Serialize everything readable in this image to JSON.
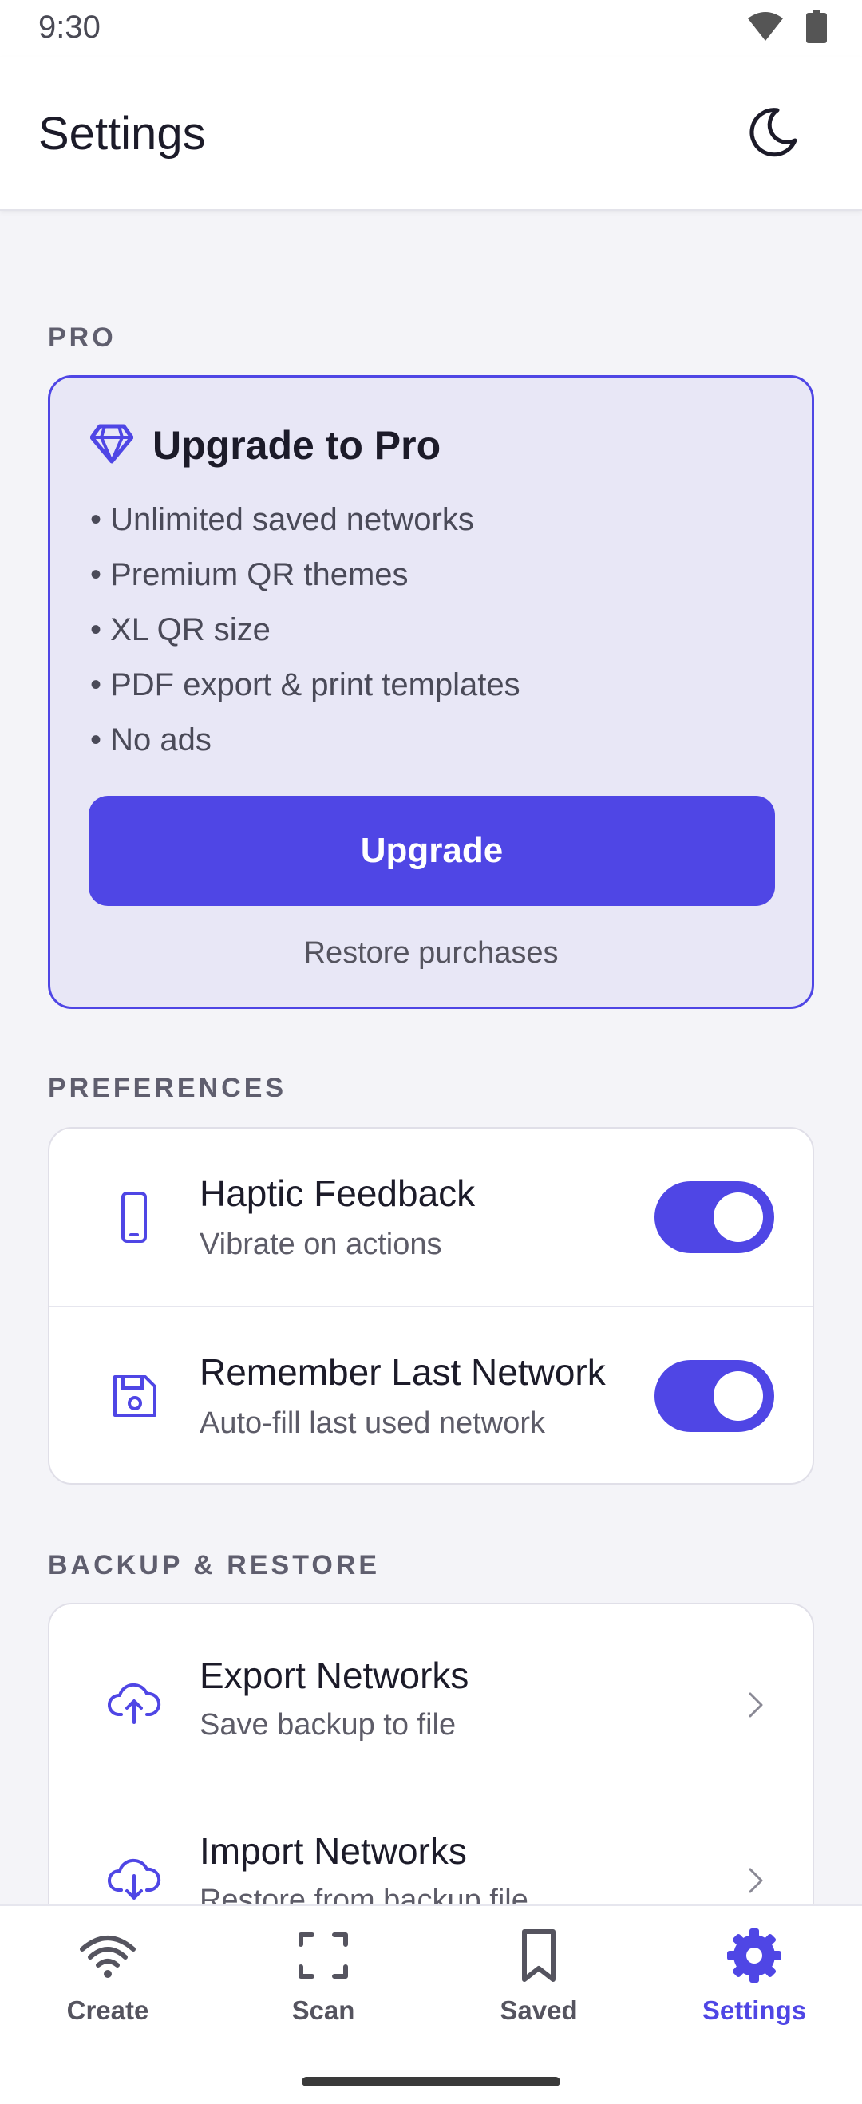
{
  "status_bar": {
    "time": "9:30",
    "icons": [
      "wifi-icon",
      "battery-icon"
    ]
  },
  "app_bar": {
    "title": "Settings",
    "action_icon": "moon-icon"
  },
  "pro_section": {
    "label": "PRO",
    "card_title": "Upgrade to Pro",
    "title_icon": "diamond-icon",
    "features": [
      "• Unlimited saved networks",
      "• Premium QR themes",
      "• XL QR size",
      "• PDF export & print templates",
      "• No ads"
    ],
    "upgrade_label": "Upgrade",
    "restore_label": "Restore purchases"
  },
  "preferences": {
    "label": "PREFERENCES",
    "items": [
      {
        "title": "Haptic Feedback",
        "subtitle": "Vibrate on actions",
        "icon": "phone-icon",
        "enabled": true
      },
      {
        "title": "Remember Last Network",
        "subtitle": "Auto-fill last used network",
        "icon": "save-icon",
        "enabled": true
      }
    ]
  },
  "backup": {
    "label": "BACKUP & RESTORE",
    "items": [
      {
        "title": "Export Networks",
        "subtitle": "Save backup to file",
        "icon": "cloud-upload-icon"
      },
      {
        "title": "Import Networks",
        "subtitle": "Restore from backup file",
        "icon": "cloud-download-icon"
      }
    ]
  },
  "bottom_nav": {
    "items": [
      {
        "label": "Create",
        "icon": "wifi-icon"
      },
      {
        "label": "Scan",
        "icon": "scan-icon"
      },
      {
        "label": "Saved",
        "icon": "bookmark-icon"
      },
      {
        "label": "Settings",
        "icon": "gear-icon",
        "active": true
      }
    ]
  },
  "colors": {
    "accent": "#4f46e5",
    "pro_card_bg": "#e8e7f6",
    "background": "#f4f4f8"
  }
}
